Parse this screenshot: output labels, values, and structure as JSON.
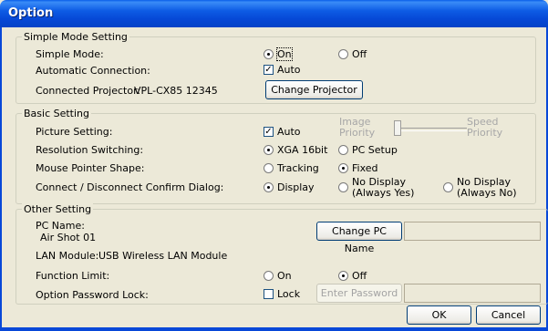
{
  "window": {
    "title": "Option"
  },
  "simple_mode": {
    "group_label": "Simple Mode Setting",
    "simple_mode_label": "Simple Mode:",
    "on_label": "On",
    "off_label": "Off",
    "simple_mode_selected": "On",
    "auto_connection_label": "Automatic Connection:",
    "auto_label": "Auto",
    "auto_checked": true,
    "connected_projector_label": "Connected Projector:",
    "connected_projector_value": "VPL-CX85 12345",
    "change_projector_button": "Change Projector"
  },
  "basic": {
    "group_label": "Basic Setting",
    "picture_setting_label": "Picture Setting:",
    "picture_auto_label": "Auto",
    "picture_auto_checked": true,
    "image_priority_label_1": "Image",
    "image_priority_label_2": "Priority",
    "speed_priority_label_1": "Speed",
    "speed_priority_label_2": "Priority",
    "resolution_label": "Resolution Switching:",
    "xga_label": "XGA 16bit",
    "pc_setup_label": "PC Setup",
    "resolution_selected": "XGA 16bit",
    "mouse_pointer_label": "Mouse Pointer Shape:",
    "tracking_label": "Tracking",
    "fixed_label": "Fixed",
    "mouse_selected": "Fixed",
    "confirm_dialog_label": "Connect / Disconnect Confirm Dialog:",
    "display_label": "Display",
    "no_display_yes_1": "No Display",
    "no_display_yes_2": "(Always Yes)",
    "no_display_no_1": "No Display",
    "no_display_no_2": "(Always No)",
    "confirm_selected": "Display"
  },
  "other": {
    "group_label": "Other Setting",
    "pc_name_label": "PC Name:",
    "pc_name_value": "Air Shot 01",
    "change_pc_name_button": "Change PC Name",
    "lan_module_label": "LAN Module:",
    "lan_module_value": "USB Wireless LAN Module",
    "function_limit_label": "Function Limit:",
    "fl_on_label": "On",
    "fl_off_label": "Off",
    "function_limit_selected": "Off",
    "password_lock_label": "Option Password Lock:",
    "lock_label": "Lock",
    "lock_checked": false,
    "enter_password_button": "Enter Password"
  },
  "footer": {
    "ok_button": "OK",
    "cancel_button": "Cancel"
  },
  "colors": {
    "titlebar": "#0648d6",
    "dialog_bg": "#ece9d8",
    "button_border": "#003c74"
  }
}
